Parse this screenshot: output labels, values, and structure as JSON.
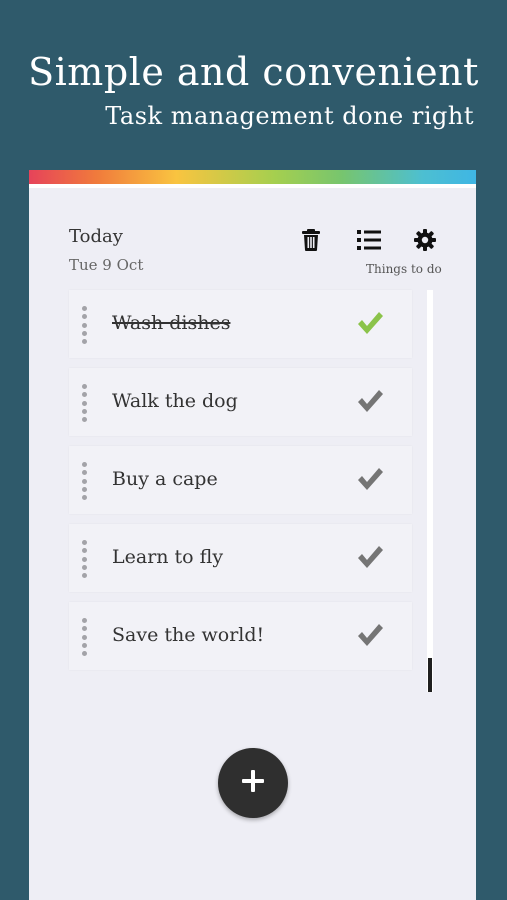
{
  "hero": {
    "title": "Simple and convenient",
    "subtitle": "Task management done right"
  },
  "header": {
    "title": "Today",
    "date": "Tue 9 Oct",
    "list_caption": "Things to do",
    "icons": [
      "trash-icon",
      "list-icon",
      "gear-icon"
    ]
  },
  "tasks": [
    {
      "label": "Wash dishes",
      "done": true
    },
    {
      "label": "Walk the dog",
      "done": false
    },
    {
      "label": "Buy a cape",
      "done": false
    },
    {
      "label": "Learn to fly",
      "done": false
    },
    {
      "label": "Save the world!",
      "done": false
    }
  ],
  "fab": {
    "icon": "plus-icon"
  },
  "colors": {
    "background": "#2f5a6b",
    "card": "#eeeef5",
    "check_done": "#8bc34a",
    "check_pending": "#757575",
    "fab": "#2f2f2f"
  }
}
